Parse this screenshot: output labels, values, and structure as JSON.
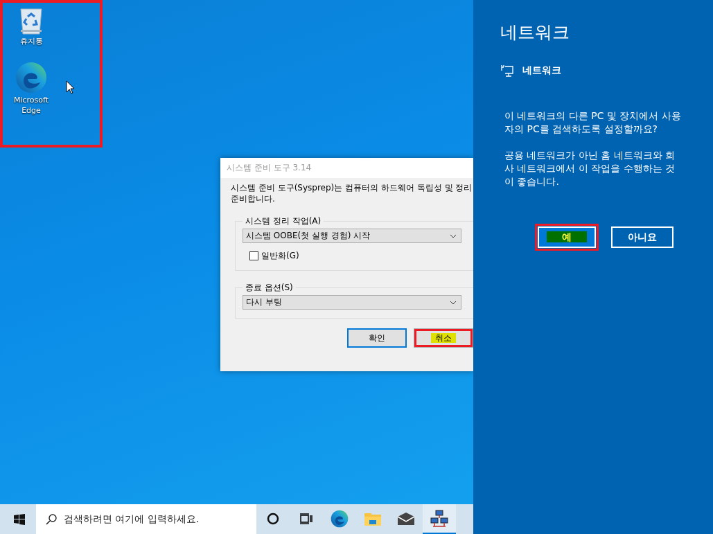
{
  "desktop": {
    "highlighted": true,
    "icons": [
      {
        "label": "휴지통",
        "kind": "recycle"
      },
      {
        "label": "Microsoft Edge",
        "kind": "edge"
      }
    ]
  },
  "dialog": {
    "title": "시스템 준비 도구 3.14",
    "description": "시스템 준비 도구(Sysprep)는 컴퓨터의 하드웨어 독립성 및 정리\n준비합니다.",
    "groups": [
      {
        "label": "시스템 정리 작업(A)",
        "value": "시스템 OOBE(첫 실행 경험) 시작",
        "checkbox": {
          "label": "일반화(G)",
          "checked": false
        }
      },
      {
        "label": "종료 옵션(S)",
        "value": "다시 부팅"
      }
    ],
    "buttons": [
      {
        "label": "확인",
        "default": true,
        "highlighted": false
      },
      {
        "label": "취소",
        "default": false,
        "highlighted": true
      }
    ]
  },
  "taskbar": {
    "search_placeholder": "검색하려면 여기에 입력하세요.",
    "apps": [
      {
        "kind": "cortana",
        "active": false
      },
      {
        "kind": "taskview",
        "active": false
      },
      {
        "kind": "edge",
        "active": false
      },
      {
        "kind": "folder",
        "active": false
      },
      {
        "kind": "mail",
        "active": false
      },
      {
        "kind": "network",
        "active": true
      }
    ]
  },
  "panel": {
    "title": "네트워크",
    "network_label": "네트워크",
    "paragraphs": [
      "이 네트워크의 다른 PC 및 장치에서 사용자의 PC를 검색하도록 설정할까요?",
      "공용 네트워크가 아닌 홈 네트워크와 회사 네트워크에서 이 작업을 수행하는 것이 좋습니다."
    ],
    "buttons": [
      {
        "label": "예",
        "primary": true,
        "highlighted": true
      },
      {
        "label": "아니요",
        "primary": false,
        "highlighted": false
      }
    ]
  }
}
